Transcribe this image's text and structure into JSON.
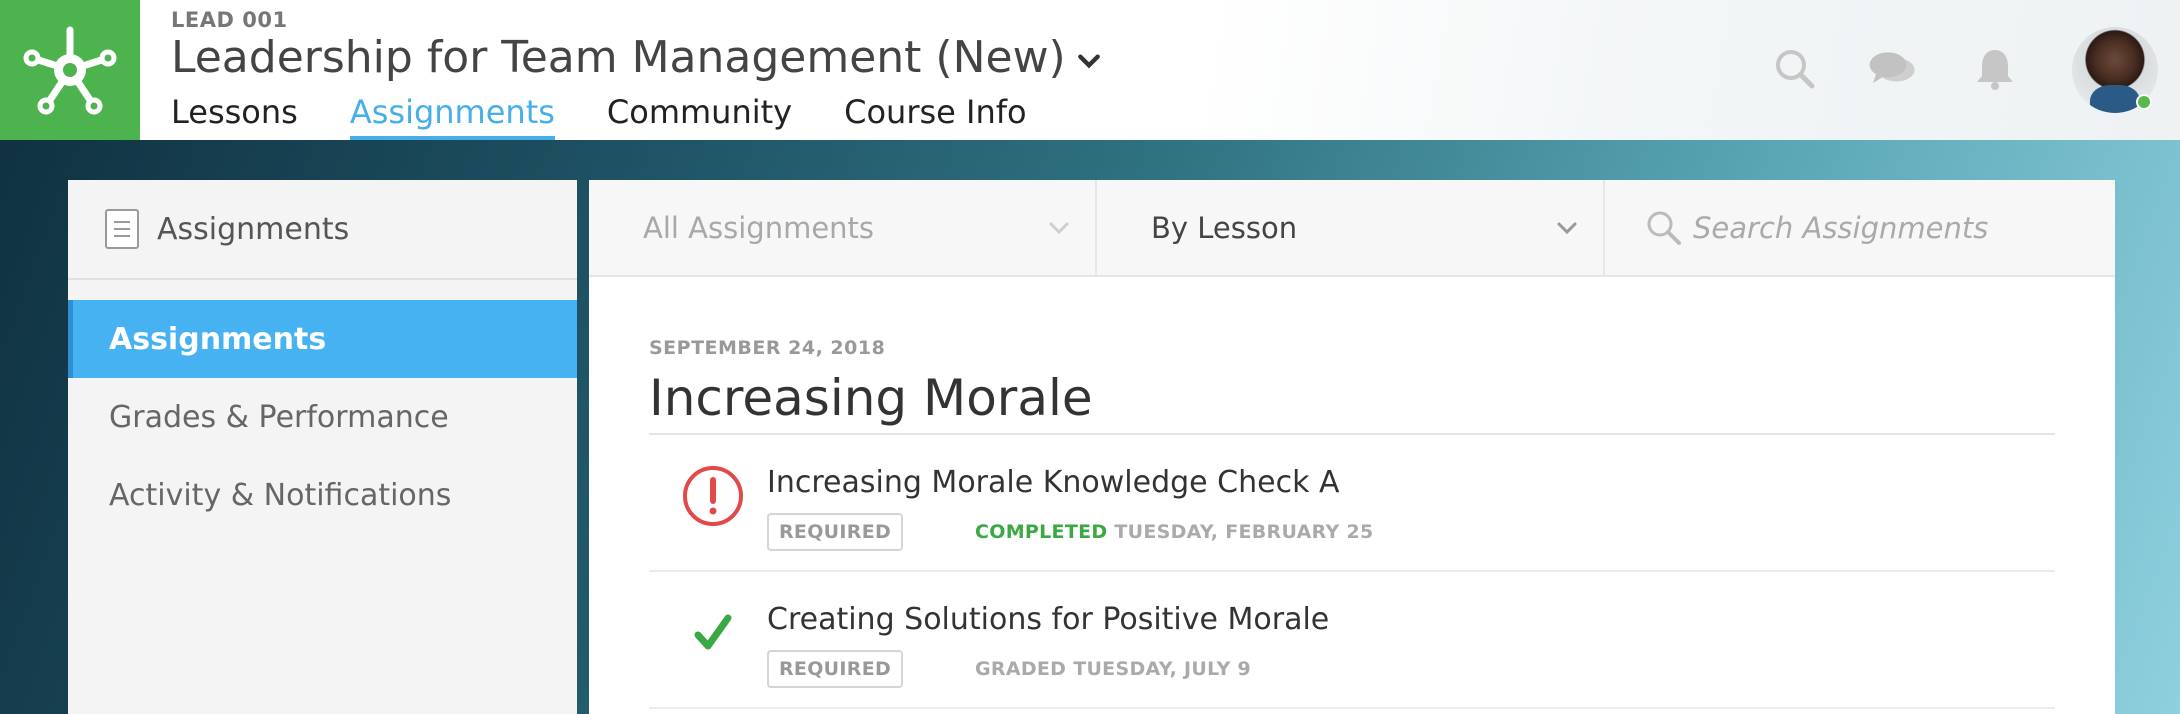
{
  "header": {
    "course_code": "LEAD 001",
    "course_title": "Leadership for Team Management (New)",
    "nav": [
      "Lessons",
      "Assignments",
      "Community",
      "Course Info"
    ],
    "active_nav": "Assignments",
    "icons": [
      "search-icon",
      "chat-icon",
      "bell-icon"
    ],
    "brand_color": "#4db34f",
    "accent_color": "#47aee9"
  },
  "sidebar": {
    "title": "Assignments",
    "items": [
      {
        "label": "Assignments",
        "active": true
      },
      {
        "label": "Grades & Performance",
        "active": false
      },
      {
        "label": "Activity & Notifications",
        "active": false
      }
    ]
  },
  "filters": {
    "type_value": "All Assignments",
    "group_value": "By Lesson",
    "search_placeholder": "Search Assignments"
  },
  "lesson": {
    "date": "SEPTEMBER 24, 2018",
    "title": "Increasing Morale",
    "assignments": [
      {
        "name": "Increasing Morale Knowledge Check A",
        "tag": "REQUIRED",
        "status_word": "COMPLETED",
        "status_date": "TUESDAY, FEBRUARY 25",
        "icon": "alert-circle-icon",
        "icon_color": "#e04a4a"
      },
      {
        "name": "Creating Solutions for Positive Morale",
        "tag": "REQUIRED",
        "status_word": "GRADED",
        "status_date": "TUESDAY, JULY 9",
        "icon": "checkmark-icon",
        "icon_color": "#3aa843"
      }
    ]
  }
}
